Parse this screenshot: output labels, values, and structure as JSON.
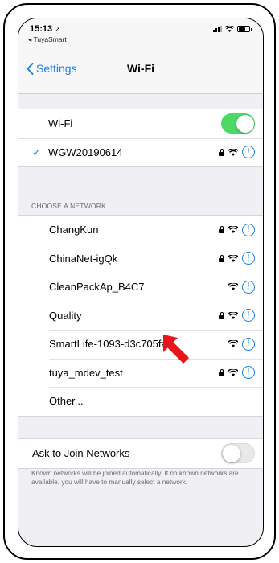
{
  "status_bar": {
    "time": "15:13",
    "location_glyph": "➚",
    "back_app": "◂ TuyaSmart"
  },
  "nav": {
    "back_label": "Settings",
    "title": "Wi-Fi"
  },
  "wifi": {
    "label": "Wi-Fi",
    "enabled": true,
    "connected_network": "WGW20190614"
  },
  "choose_header": "CHOOSE A NETWORK...",
  "networks": [
    {
      "name": "ChangKun",
      "locked": true
    },
    {
      "name": "ChinaNet-igQk",
      "locked": true
    },
    {
      "name": "CleanPackAp_B4C7",
      "locked": false
    },
    {
      "name": "Quality",
      "locked": true
    },
    {
      "name": "SmartLife-1093-d3c705fa",
      "locked": false,
      "highlighted": true
    },
    {
      "name": "tuya_mdev_test",
      "locked": true
    }
  ],
  "other_label": "Other...",
  "ask_to_join": {
    "label": "Ask to Join Networks",
    "enabled": false
  },
  "footer": "Known networks will be joined automatically. If no known networks are available, you will have to manually select a network.",
  "colors": {
    "accent": "#1a7fe6",
    "toggle_on": "#4cd964",
    "arrow": "#e8141c"
  },
  "icons": {
    "info": "i",
    "check": "✓"
  }
}
